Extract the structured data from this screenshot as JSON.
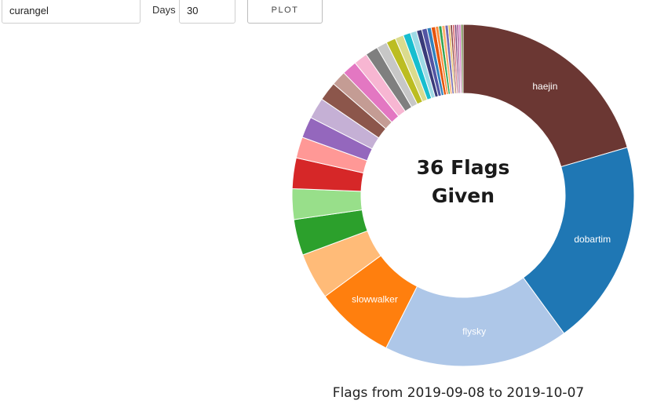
{
  "controls": {
    "user_value": "curangel",
    "days_label": "Days",
    "days_value": "30",
    "plot_label": "PLOT"
  },
  "chart_data": {
    "type": "pie",
    "donut": true,
    "center_title": [
      "36 Flags",
      "Given"
    ],
    "caption": "Flags from 2019-09-08 to 2019-10-07",
    "slices": [
      {
        "label": "haejin",
        "value": 20.5,
        "color": "#6b3733",
        "show_label": true
      },
      {
        "label": "dobartim",
        "value": 19.5,
        "color": "#1f77b4",
        "show_label": true
      },
      {
        "label": "flysky",
        "value": 17.5,
        "color": "#aec7e8",
        "show_label": true
      },
      {
        "label": "slowwalker",
        "value": 7.5,
        "color": "#ff7f0e",
        "show_label": true
      },
      {
        "label": "",
        "value": 4.4,
        "color": "#ffbb78",
        "show_label": false
      },
      {
        "label": "",
        "value": 3.4,
        "color": "#2ca02c",
        "show_label": false
      },
      {
        "label": "",
        "value": 2.9,
        "color": "#98df8a",
        "show_label": false
      },
      {
        "label": "",
        "value": 2.9,
        "color": "#d62728",
        "show_label": false
      },
      {
        "label": "",
        "value": 2.0,
        "color": "#ff9896",
        "show_label": false
      },
      {
        "label": "",
        "value": 2.0,
        "color": "#9467bd",
        "show_label": false
      },
      {
        "label": "",
        "value": 2.0,
        "color": "#c5b0d5",
        "show_label": false
      },
      {
        "label": "",
        "value": 1.8,
        "color": "#8c564b",
        "show_label": false
      },
      {
        "label": "",
        "value": 1.4,
        "color": "#c49c94",
        "show_label": false
      },
      {
        "label": "",
        "value": 1.4,
        "color": "#e377c2",
        "show_label": false
      },
      {
        "label": "",
        "value": 1.3,
        "color": "#f7b6d2",
        "show_label": false
      },
      {
        "label": "",
        "value": 1.2,
        "color": "#7f7f7f",
        "show_label": false
      },
      {
        "label": "",
        "value": 1.0,
        "color": "#c7c7c7",
        "show_label": false
      },
      {
        "label": "",
        "value": 0.9,
        "color": "#bcbd22",
        "show_label": false
      },
      {
        "label": "",
        "value": 0.8,
        "color": "#dbdb8d",
        "show_label": false
      },
      {
        "label": "",
        "value": 0.7,
        "color": "#17becf",
        "show_label": false
      },
      {
        "label": "",
        "value": 0.6,
        "color": "#9edae5",
        "show_label": false
      },
      {
        "label": "",
        "value": 0.5,
        "color": "#393b79",
        "show_label": false
      },
      {
        "label": "",
        "value": 0.5,
        "color": "#5254a3",
        "show_label": false
      },
      {
        "label": "",
        "value": 0.4,
        "color": "#3182bd",
        "show_label": false
      },
      {
        "label": "",
        "value": 0.4,
        "color": "#e6550d",
        "show_label": false
      },
      {
        "label": "",
        "value": 0.3,
        "color": "#fd8d3c",
        "show_label": false
      },
      {
        "label": "",
        "value": 0.3,
        "color": "#31a354",
        "show_label": false
      },
      {
        "label": "",
        "value": 0.3,
        "color": "#fdae6b",
        "show_label": false
      },
      {
        "label": "",
        "value": 0.3,
        "color": "#756bb1",
        "show_label": false
      },
      {
        "label": "",
        "value": 0.2,
        "color": "#e7ba52",
        "show_label": false
      },
      {
        "label": "",
        "value": 0.2,
        "color": "#843c39",
        "show_label": false
      },
      {
        "label": "",
        "value": 0.2,
        "color": "#d6616b",
        "show_label": false
      },
      {
        "label": "",
        "value": 0.2,
        "color": "#7b4173",
        "show_label": false
      },
      {
        "label": "",
        "value": 0.2,
        "color": "#a55194",
        "show_label": false
      },
      {
        "label": "",
        "value": 0.2,
        "color": "#ce6dbd",
        "show_label": false
      },
      {
        "label": "",
        "value": 0.2,
        "color": "#637939",
        "show_label": false
      }
    ]
  }
}
